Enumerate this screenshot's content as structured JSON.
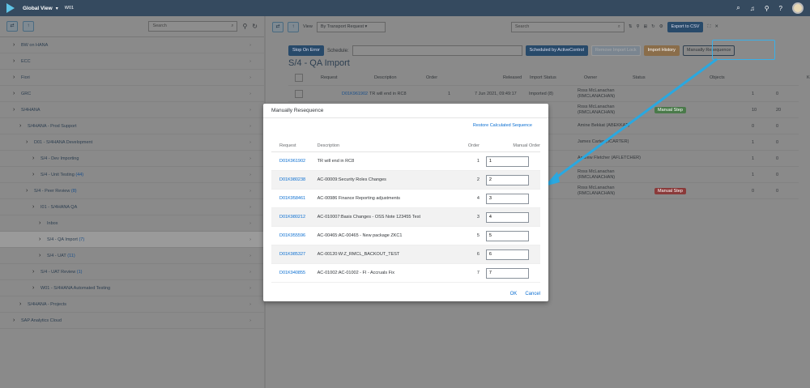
{
  "shell": {
    "title": "Global View",
    "subtitle": "W01"
  },
  "left": {
    "search_placeholder": "Search",
    "tree": [
      {
        "label": "BW on HANA",
        "count": "",
        "indent": 0
      },
      {
        "label": "ECC",
        "count": "",
        "indent": 0
      },
      {
        "label": "Fiori",
        "count": "",
        "indent": 0
      },
      {
        "label": "GRC",
        "count": "",
        "indent": 0
      },
      {
        "label": "S/4HANA",
        "count": "",
        "indent": 0
      },
      {
        "label": "S/4HANA - Prod Support",
        "count": "",
        "indent": 1
      },
      {
        "label": "D01 - S/4HANA Development",
        "count": "",
        "indent": 2
      },
      {
        "label": "S/4 - Dev Importing",
        "count": "",
        "indent": 3
      },
      {
        "label": "S/4 - Unit Testing",
        "count": "(44)",
        "indent": 3
      },
      {
        "label": "S/4 - Peer Review",
        "count": "(8)",
        "indent": 2
      },
      {
        "label": "I01 - S/4HANA QA",
        "count": "",
        "indent": 3
      },
      {
        "label": "Inbox",
        "count": "",
        "indent": 4
      },
      {
        "label": "S/4 - QA Import",
        "count": "(7)",
        "indent": 4
      },
      {
        "label": "S/4 - UAT",
        "count": "(11)",
        "indent": 4
      },
      {
        "label": "S/4 - UAT Review",
        "count": "(1)",
        "indent": 3
      },
      {
        "label": "W01 - S/4HANA Automated Testing",
        "count": "",
        "indent": 3
      },
      {
        "label": "S/4HANA - Projects",
        "count": "",
        "indent": 1
      },
      {
        "label": "SAP Analytics Cloud",
        "count": "",
        "indent": 0
      }
    ]
  },
  "right": {
    "view_label": "View",
    "view_value": "By Transport Request",
    "search_placeholder": "Search",
    "export": "Export to CSV",
    "stop_on_error": "Stop On Error",
    "schedule": "Schedule:",
    "scheduled_by": "Scheduled by ActiveControl",
    "remove_lock": "Remove Import Lock",
    "import_history": "Import History",
    "manually_resequence": "Manually Resequence",
    "title": "S/4 - QA Import",
    "cols": [
      "Request",
      "Description",
      "Order",
      "Released",
      "Import Status",
      "Owner",
      "Status",
      "Objects",
      "Keys"
    ],
    "rows": [
      {
        "req": "D01K961902",
        "desc": "TR will end in RC8",
        "order": "1",
        "rel": "7 Jun 2021, 09:49:17",
        "imp": "Imported (8)",
        "owner": "Ross McLanachan (RMCLANACHAN)",
        "status": "",
        "obj": "1",
        "keys": "0"
      },
      {
        "owner": "Ross McLanachan (RMCLANACHAN)",
        "status": "Manual Step",
        "obj": "10",
        "keys": "20"
      },
      {
        "owner": "Amine Bekkat (ABEKKAT)",
        "status": "",
        "obj": "0",
        "keys": "0"
      },
      {
        "owner": "James Carter (JCARTER)",
        "status": "",
        "obj": "1",
        "keys": "0"
      },
      {
        "owner": "Andrew Fletcher (AFLETCHER)",
        "status": "",
        "obj": "1",
        "keys": "0"
      },
      {
        "owner": "Ross McLanachan (RMCLANACHAN)",
        "status": "",
        "obj": "1",
        "keys": "0"
      },
      {
        "owner": "Ross McLanachan (RMCLANACHAN)",
        "status": "Manual Step",
        "obj": "0",
        "keys": "0"
      }
    ]
  },
  "modal": {
    "title": "Manually Resequence",
    "restore": "Restore Calculated Sequence",
    "cols": [
      "Request",
      "Description",
      "Order",
      "Manual Order"
    ],
    "rows": [
      {
        "req": "D01K961902",
        "desc": "TR will end in RC8",
        "order": "1",
        "manual": "1"
      },
      {
        "req": "D01K980238",
        "desc": "AC-00009:Security Roles Changes",
        "order": "2",
        "manual": "2"
      },
      {
        "req": "D01K958461",
        "desc": "AC-00986 Finance Reporting adjustments",
        "order": "4",
        "manual": "3"
      },
      {
        "req": "D01K980212",
        "desc": "AC-010007:Basis Changes - OSS Note 123455 Test",
        "order": "3",
        "manual": "4"
      },
      {
        "req": "D01K955596",
        "desc": "AC-00465:AC-00465 - New package ZKC1",
        "order": "5",
        "manual": "5"
      },
      {
        "req": "D01K985327",
        "desc": "AC-00120:W:Z_RMCL_BACKOUT_TEST",
        "order": "6",
        "manual": "6"
      },
      {
        "req": "D01K940855",
        "desc": "AC-01002:AC-01002 - FI - Accruals Fix",
        "order": "7",
        "manual": "7"
      }
    ],
    "ok": "OK",
    "cancel": "Cancel"
  }
}
